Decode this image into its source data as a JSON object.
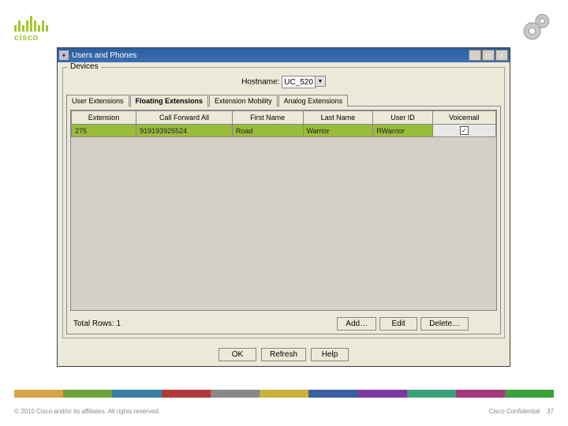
{
  "logo_text": "cisco",
  "window": {
    "title": "Users and Phones",
    "fieldset": "Devices",
    "hostname_label": "Hostname:",
    "hostname_value": "UC_520"
  },
  "tabs": [
    "User Extensions",
    "Floating Extensions",
    "Extension Mobility",
    "Analog Extensions"
  ],
  "columns": [
    "Extension",
    "Call Forward All",
    "First Name",
    "Last Name",
    "User ID",
    "Voicemail"
  ],
  "row": {
    "extension": "275",
    "cfa": "919193925524",
    "first": "Road",
    "last": "Warrior",
    "userid": "RWarrior",
    "voicemail": true
  },
  "total_rows_label": "Total Rows: 1",
  "buttons": {
    "add": "Add…",
    "edit": "Edit",
    "delete": "Delete…",
    "ok": "OK",
    "refresh": "Refresh",
    "help": "Help"
  },
  "footer": {
    "copyright": "© 2010 Cisco and/or its affiliates. All rights reserved.",
    "confidential": "Cisco Confidential",
    "page": "37"
  },
  "stripe_colors": [
    "#d9a34a",
    "#6fa23a",
    "#3a7fa2",
    "#b33a3a",
    "#888888",
    "#c9b23a",
    "#3a5fa2",
    "#7a3aa2",
    "#3aa27a",
    "#a23a7a",
    "#3aa23a"
  ]
}
